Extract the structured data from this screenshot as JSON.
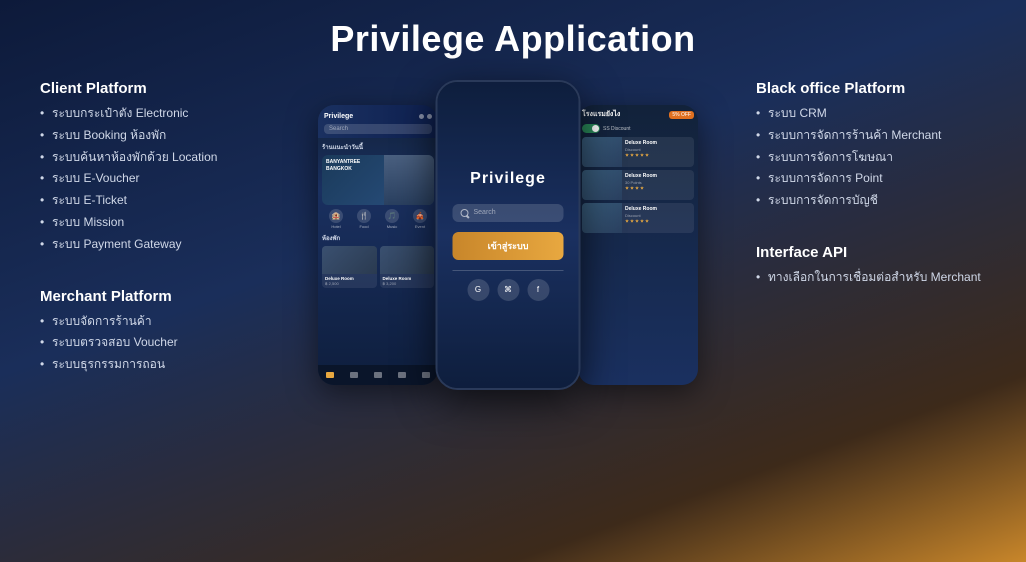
{
  "title": "Privilege Application",
  "client_platform": {
    "title": "Client Platform",
    "items": [
      "ระบบกระเป๋าตัง Electronic",
      "ระบบ Booking ห้องพัก",
      "ระบบค้นหาห้องพักด้วย Location",
      "ระบบ E-Voucher",
      "ระบบ E-Ticket",
      "ระบบ Mission",
      "ระบบ Payment Gateway"
    ]
  },
  "merchant_platform": {
    "title": "Merchant Platform",
    "items": [
      "ระบบจัดการร้านค้า",
      "ระบบตรวจสอบ Voucher",
      "ระบบธุรกรรมการถอน"
    ]
  },
  "black_office_platform": {
    "title": "Black office Platform",
    "items": [
      "ระบบ CRM",
      "ระบบการจัดการร้านค้า Merchant",
      "ระบบการจัดการโฆษณา",
      "ระบบการจัดการ Point",
      "ระบบการจัดการบัญชี"
    ]
  },
  "interface_api": {
    "title": "Interface API",
    "items": [
      "ทางเลือกในการเชื่อมต่อสำหรับ Merchant"
    ]
  },
  "phone_left": {
    "app_name": "Privilege",
    "search_placeholder": "Search",
    "banner_line1": "BANYANTREE",
    "banner_line2": "BANGKOK",
    "section": "ห้องพัก",
    "room1": "Deluxe Room",
    "room2": "Deluxe Room"
  },
  "phone_center": {
    "app_name": "Privilege",
    "search_placeholder": "Search",
    "login_btn": "เข้าสู่ระบบ"
  },
  "phone_right": {
    "section": "โรงแรมยังไง",
    "discount": "5% OFF",
    "room1": "Deluxe Room",
    "room2": "Deluxe Room",
    "room3": "Deluxe Room"
  }
}
